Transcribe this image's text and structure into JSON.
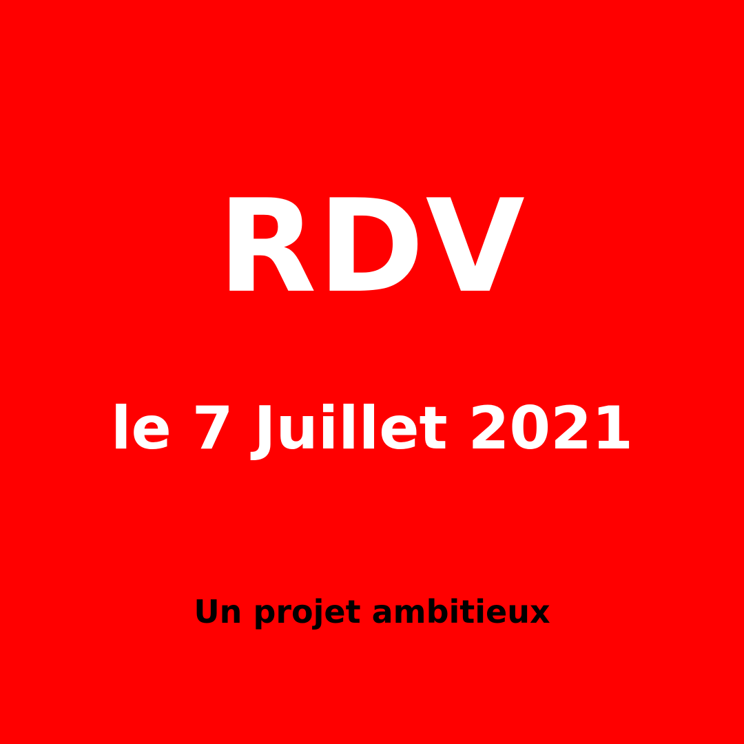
{
  "colors": {
    "background": "#ff0000",
    "headline": "#ffffff",
    "date": "#ffffff",
    "tagline": "#000000"
  },
  "headline": "RDV",
  "date": "le 7 Juillet 2021",
  "tagline": "Un projet ambitieux"
}
